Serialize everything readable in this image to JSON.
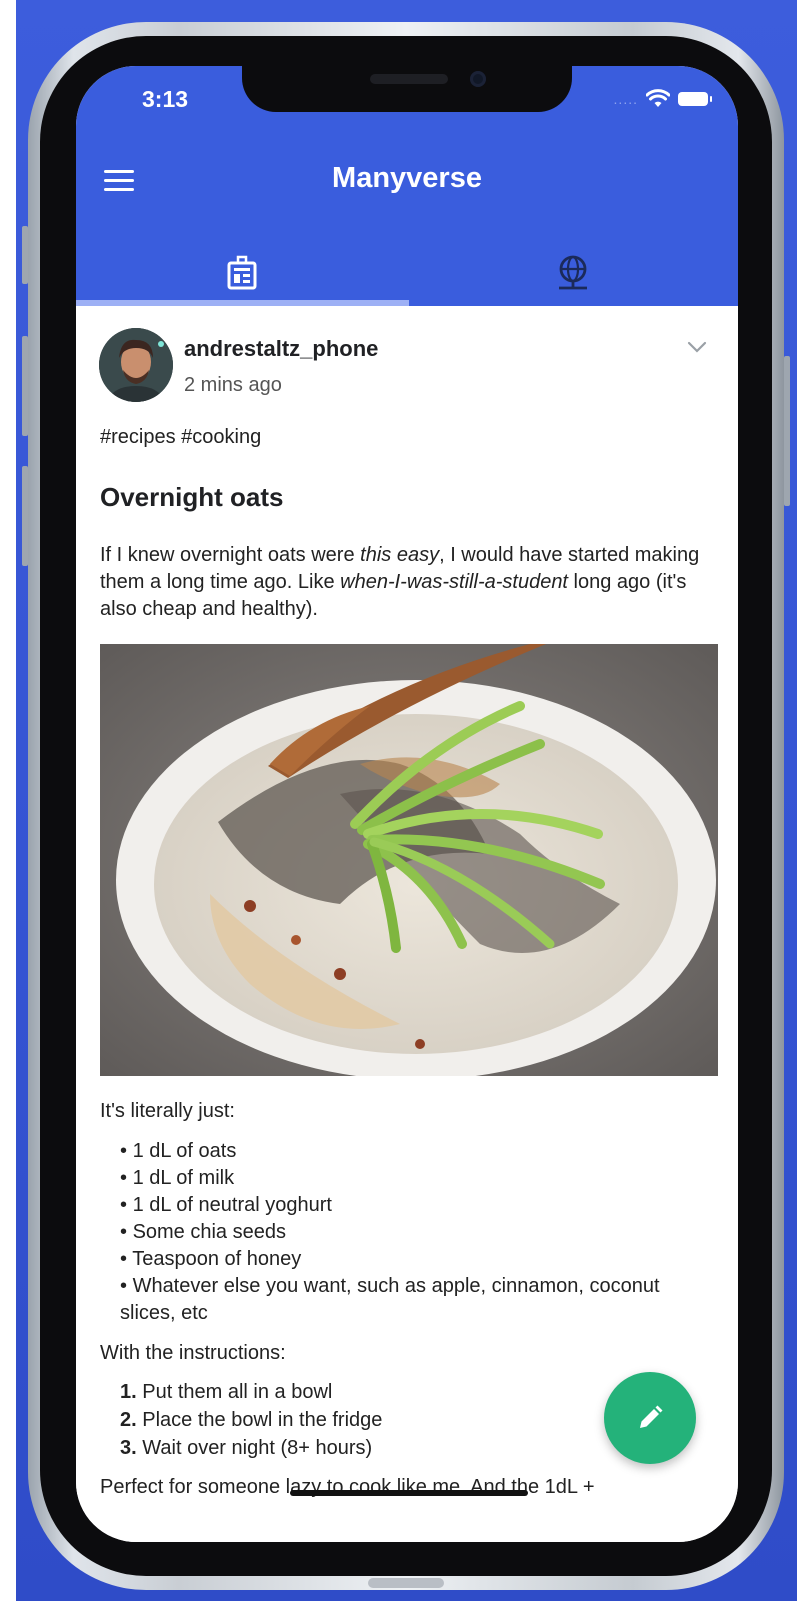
{
  "status": {
    "time": "3:13",
    "carrier_dots": "....."
  },
  "appbar": {
    "title": "Manyverse",
    "tabs": [
      "public-feed",
      "connections"
    ]
  },
  "post": {
    "author": "andrestaltz_phone",
    "timestamp": "2 mins ago",
    "tags": "#recipes #cooking",
    "heading": "Overnight oats",
    "intro_parts": [
      "If I knew overnight oats were ",
      "this easy",
      ", I would have started making them a long time ago. Like ",
      "when-I-was-still-a-student",
      " long ago (it's also cheap and healthy)."
    ],
    "list_intro": "It's literally just:",
    "ingredients": [
      "1 dL of oats",
      "1 dL of milk",
      "1 dL of neutral yoghurt",
      "Some chia seeds",
      "Teaspoon of honey",
      "Whatever else you want, such as apple, cinnamon, coconut slices, etc"
    ],
    "instructions_intro": "With the instructions:",
    "instructions": [
      {
        "num": "1.",
        "text": "Put them all in a bowl"
      },
      {
        "num": "2.",
        "text": "Place the bowl in the fridge"
      },
      {
        "num": "3.",
        "text": "Wait over night (8+ hours)"
      }
    ],
    "closing": "Perfect for someone lazy to cook like me. And the 1dL +"
  },
  "icons": {
    "menu": "hamburger-menu-icon",
    "public": "public-feed-icon",
    "connections": "globe-network-icon",
    "options": "chevron-down-icon",
    "compose": "pencil-icon"
  },
  "colors": {
    "appbar": "#3a5ddd",
    "fab": "#24b27a",
    "background": "#3a58d6"
  }
}
